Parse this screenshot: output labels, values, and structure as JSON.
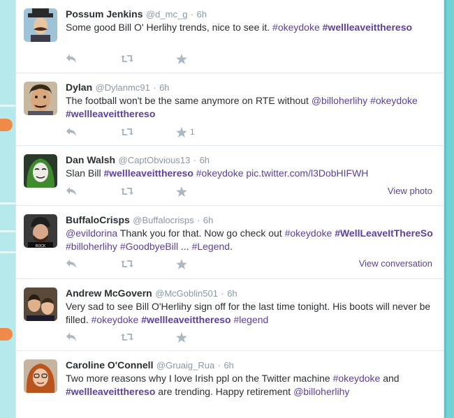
{
  "colors": {
    "link": "#5c3f9e",
    "meta": "#8899a6",
    "text": "#292f33",
    "background": "#6fd0d4"
  },
  "tweets": [
    {
      "fullname": "Possum Jenkins",
      "screenname": "@d_mc_g",
      "time": "6h",
      "text": [
        {
          "t": "Some good Bill O' Herlihy trends, nice to see it. "
        },
        {
          "t": "#okeydoke",
          "k": "tag"
        },
        {
          "t": " "
        },
        {
          "t": "#wellleaveitthereso",
          "k": "tagb"
        }
      ],
      "fav_count": "",
      "view_link": "",
      "avatar_icon": "avatar-moustache-man"
    },
    {
      "fullname": "Dylan",
      "screenname": "@Dylanmc91",
      "time": "6h",
      "text": [
        {
          "t": "The football won't be the same anymore on RTE without "
        },
        {
          "t": "@billoherlihy",
          "k": "mention"
        },
        {
          "t": " "
        },
        {
          "t": "#okeydoke",
          "k": "tag"
        },
        {
          "t": " "
        },
        {
          "t": "#wellleaveitthereso",
          "k": "tagb"
        }
      ],
      "fav_count": "1",
      "view_link": "",
      "avatar_icon": "avatar-cartoon-man"
    },
    {
      "fullname": "Dan Walsh",
      "screenname": "@CaptObvious13",
      "time": "6h",
      "text": [
        {
          "t": "Slan Bill "
        },
        {
          "t": "#wellleaveitthereso",
          "k": "tagb"
        },
        {
          "t": " "
        },
        {
          "t": "#okeydoke",
          "k": "tag"
        },
        {
          "t": " "
        },
        {
          "t": "pic.twitter.com/l3DobHIFWH",
          "k": "link"
        }
      ],
      "fav_count": "",
      "view_link": "View photo",
      "avatar_icon": "avatar-mask-hood"
    },
    {
      "fullname": "BuffaloCrisps",
      "screenname": "@Buffalocrisps",
      "time": "6h",
      "text": [
        {
          "t": "@evildorina",
          "k": "mention"
        },
        {
          "t": " Thank you for that. Now go check out "
        },
        {
          "t": "#okeydoke",
          "k": "tag"
        },
        {
          "t": " "
        },
        {
          "t": "#WellLeaveItThereSo",
          "k": "tagb"
        },
        {
          "t": " "
        },
        {
          "t": "#billoherlihy",
          "k": "tag"
        },
        {
          "t": " "
        },
        {
          "t": "#GoodbyeBill",
          "k": "tag"
        },
        {
          "t": " ... "
        },
        {
          "t": "#Legend",
          "k": "tag"
        },
        {
          "t": "."
        }
      ],
      "fav_count": "",
      "view_link": "View conversation",
      "avatar_icon": "avatar-beanie-man"
    },
    {
      "fullname": "Andrew McGovern",
      "screenname": "@McGoblin501",
      "time": "6h",
      "text": [
        {
          "t": "Very sad to see Bill O'Herlihy sign off for the last time tonight. His boots will never be filled. "
        },
        {
          "t": "#okeydoke",
          "k": "tag"
        },
        {
          "t": " "
        },
        {
          "t": "#wellleaveitthereso",
          "k": "tagb"
        },
        {
          "t": " "
        },
        {
          "t": "#legend",
          "k": "tag"
        }
      ],
      "fav_count": "",
      "view_link": "",
      "avatar_icon": "avatar-two-men"
    },
    {
      "fullname": "Caroline O'Connell",
      "screenname": "@Gruaig_Rua",
      "time": "6h",
      "text": [
        {
          "t": "Two more reasons why I love Irish ppl on the Twitter machine "
        },
        {
          "t": "#okeydoke",
          "k": "tag"
        },
        {
          "t": " and "
        },
        {
          "t": "#wellleaveitthereso",
          "k": "tagb"
        },
        {
          "t": " are trending. Happy retirement "
        },
        {
          "t": "@billoherlihy",
          "k": "mention"
        }
      ],
      "fav_count": "",
      "view_link": "",
      "avatar_icon": "avatar-red-hair-woman"
    }
  ]
}
